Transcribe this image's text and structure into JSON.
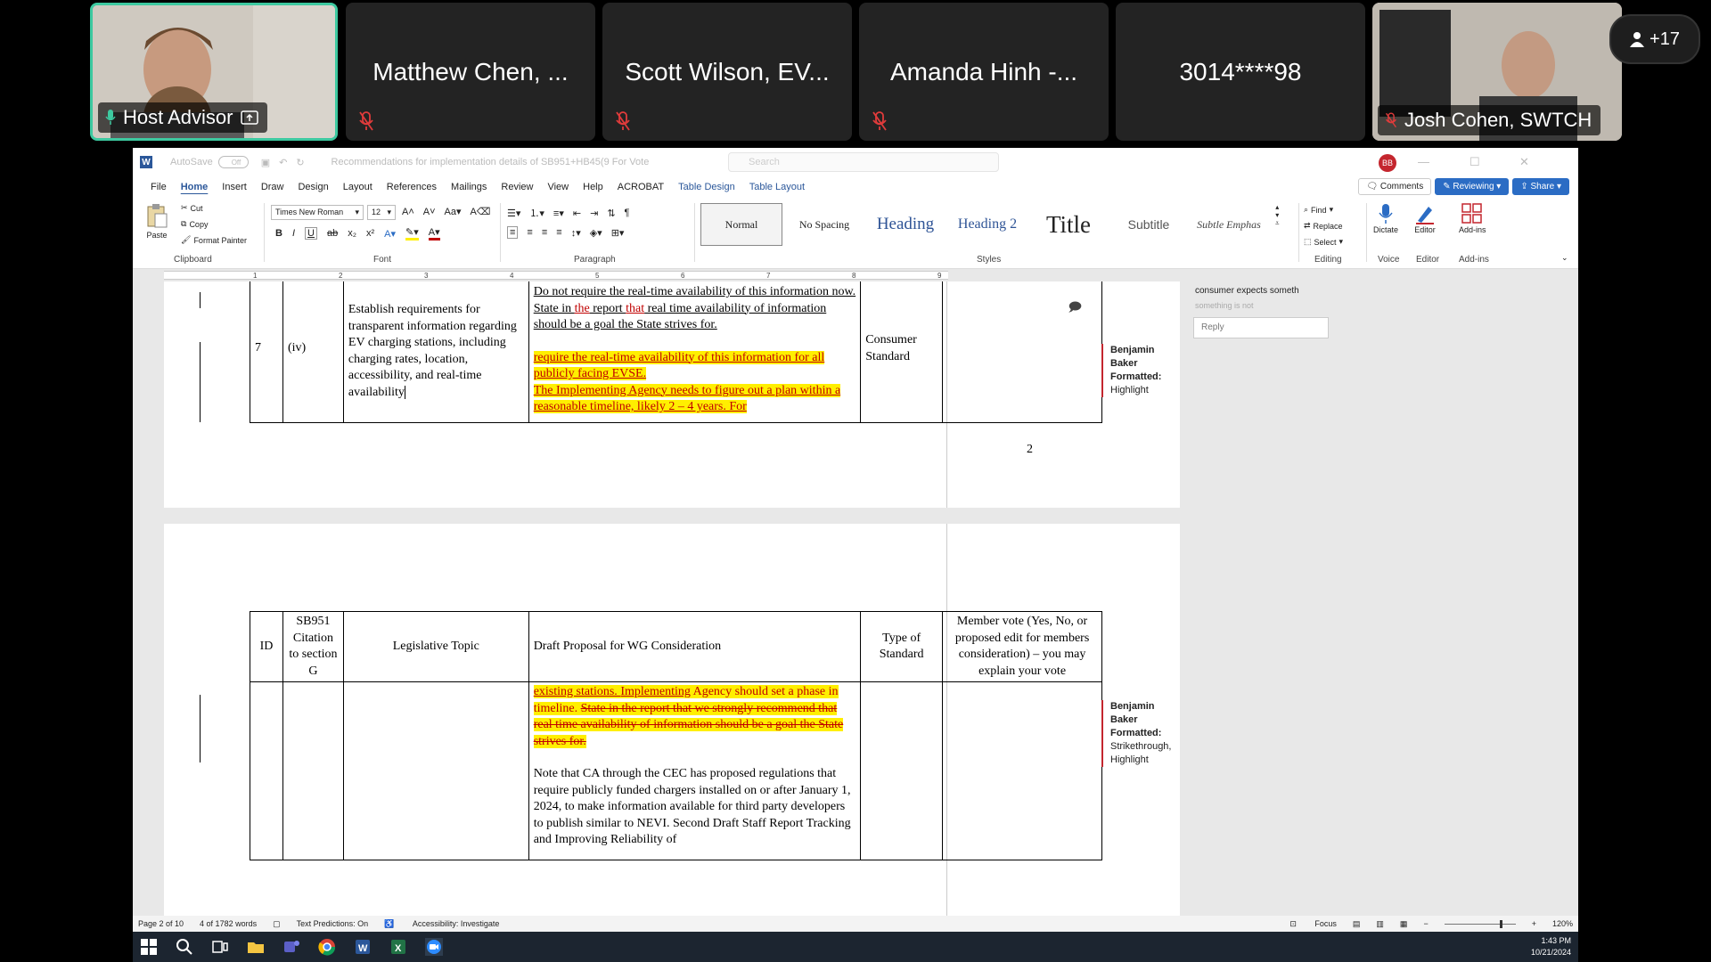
{
  "meeting": {
    "host_tile_name": "Host Advisor",
    "tiles": [
      {
        "name": "Matthew Chen, ..."
      },
      {
        "name": "Scott Wilson, EV..."
      },
      {
        "name": "Amanda Hinh -..."
      },
      {
        "name": "3014****98"
      }
    ],
    "right_tile_name": "Josh Cohen, SWTCH",
    "participant_count": "+17",
    "colors": {
      "tile_bg": "#232323",
      "host_border": "#3dc9a0",
      "muted_icon": "#e03b3b"
    }
  },
  "word": {
    "autosave_label": "AutoSave",
    "autosave_state": "Off",
    "doc_title": "Recommendations for implementation details of SB951+HB45(9 For Vote",
    "search_placeholder": "Search",
    "user_initials": "BB",
    "menu": [
      "File",
      "Home",
      "Insert",
      "Draw",
      "Design",
      "Layout",
      "References",
      "Mailings",
      "Review",
      "View",
      "Help",
      "ACROBAT",
      "Table Design",
      "Table Layout"
    ],
    "active_menu": "Home",
    "comments_btn": "Comments",
    "reviewing_btn": "Reviewing",
    "share_btn": "Share",
    "ribbon": {
      "clipboard": {
        "paste": "Paste",
        "cut": "Cut",
        "copy": "Copy",
        "format_painter": "Format Painter",
        "label": "Clipboard"
      },
      "font": {
        "name": "Times New Roman",
        "size": "12",
        "label": "Font"
      },
      "paragraph_label": "Paragraph",
      "styles": [
        "Normal",
        "No Spacing",
        "Heading",
        "Heading 2",
        "Title",
        "Subtitle",
        "Subtle Emphas"
      ],
      "styles_label": "Styles",
      "editing": {
        "find": "Find",
        "replace": "Replace",
        "select": "Select",
        "label": "Editing"
      },
      "voice": {
        "dictate": "Dictate",
        "label": "Voice"
      },
      "editor": {
        "editor": "Editor",
        "label": "Editor"
      },
      "addins": {
        "addins": "Add-ins",
        "label": "Add-ins"
      }
    },
    "ruler_ticks": [
      "1",
      "2",
      "3",
      "4",
      "5",
      "6",
      "7",
      "8",
      "9"
    ],
    "page1": {
      "row": {
        "id": "7",
        "citation": "(iv)",
        "topic": "Establish requirements for transparent information regarding EV charging stations, including charging rates, location, accessibility, and real-time availability",
        "proposal_p1_a": "Do not require the real-time availability of this information now.  State in ",
        "proposal_p1_the": "the",
        "proposal_p1_b": " report ",
        "proposal_p1_that": "that",
        "proposal_p1_c": " real time availability of information should be a goal the State strives for.",
        "proposal_p2": "require the real-time availability of this information for all publicly facing EVSE.",
        "proposal_p3": "The Implementing Agency needs to figure out a plan within a reasonable timeline, likely 2 – 4 years.   For",
        "type": "Consumer Standard"
      },
      "page_number": "2",
      "balloon": {
        "author": "Benjamin Baker",
        "label": "Formatted:",
        "value": "Highlight"
      }
    },
    "page2": {
      "headers": [
        "ID",
        "SB951 Citation to section G",
        "Legislative Topic",
        "Draft Proposal for WG Consideration",
        "Type of Standard",
        "Member vote (Yes, No, or proposed edit for members consideration) – you may explain your vote"
      ],
      "cont_a": "existing stations. ",
      "cont_b": "Implementing",
      "cont_c": " Agency should set a phase in timeline.  ",
      "cont_strike": "State in the report that we strongly recommend that real time availability of information should be a goal the State strives for.",
      "note": "Note that CA through the CEC has proposed regulations that require publicly funded chargers installed on or after January 1, 2024, to make information available for third party developers to publish similar to NEVI.  Second Draft Staff Report Tracking and Improving Reliability of",
      "balloon": {
        "author": "Benjamin Baker",
        "label": "Formatted:",
        "value": "Strikethrough, Highlight"
      }
    },
    "comment_pane": {
      "text": "consumer expects someth",
      "text2": "something is not",
      "reply_placeholder": "Reply"
    },
    "status": {
      "page": "Page 2 of 10",
      "words": "4 of 1782 words",
      "predictions": "Text Predictions: On",
      "accessibility": "Accessibility: Investigate",
      "focus": "Focus",
      "zoom": "120%"
    }
  },
  "taskbar": {
    "time": "1:43 PM",
    "date": "10/21/2024"
  }
}
